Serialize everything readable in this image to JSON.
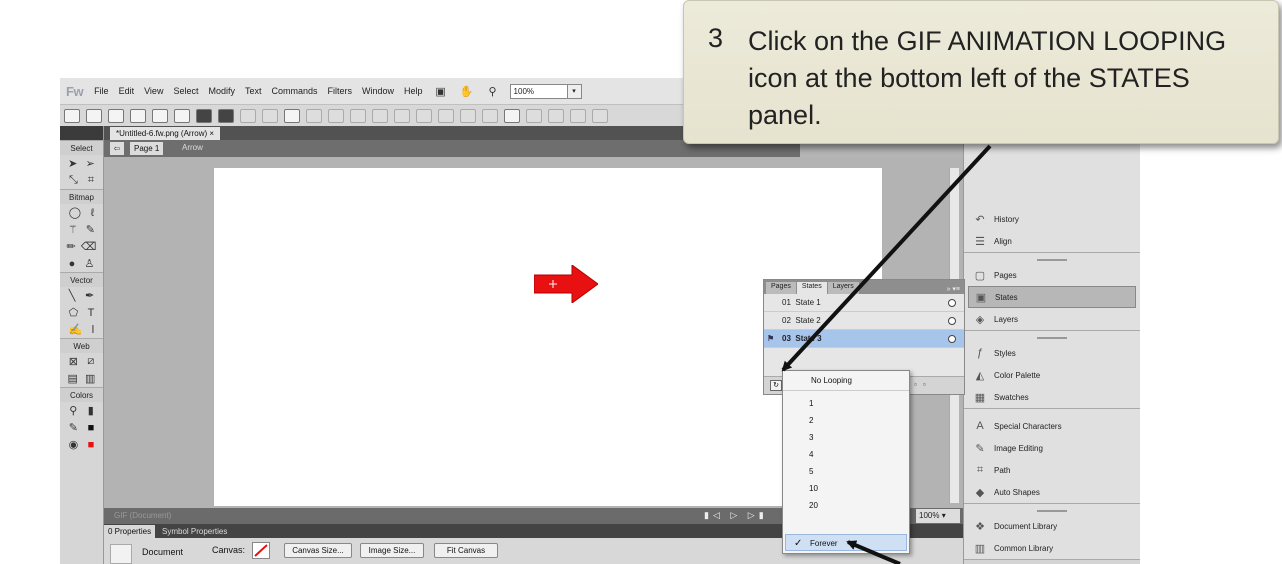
{
  "callout": {
    "step": "3",
    "text": "Click on the GIF ANIMATION LOOPING icon at the bottom left of the STATES panel."
  },
  "app": {
    "logo": "Fw",
    "menu": [
      "File",
      "Edit",
      "View",
      "Select",
      "Modify",
      "Text",
      "Commands",
      "Filters",
      "Window",
      "Help"
    ],
    "zoom": "100%",
    "document_tab": "*Untitled-6.fw.png (Arrow)",
    "tab_close": "×",
    "page_label": "Page 1",
    "layer_label": "Arrow"
  },
  "tools": {
    "sections": [
      "Select",
      "Bitmap",
      "Vector",
      "Web",
      "Colors"
    ]
  },
  "status": {
    "doc_type": "GIF (Document)",
    "playback": "▮◁ ▷ ▷▮",
    "zoom": "100%",
    "zoom_arrow": "▾"
  },
  "properties": {
    "tabs": [
      "0 Properties",
      "Symbol Properties"
    ],
    "document_label": "Document",
    "canvas_label": "Canvas:",
    "canvas_size_button": "Canvas Size...",
    "image_size_button": "Image Size...",
    "fit_canvas_button": "Fit Canvas"
  },
  "right_panel": {
    "group1": [
      "History",
      "Align"
    ],
    "group2": [
      "Pages",
      "States",
      "Layers"
    ],
    "group3": [
      "Styles",
      "Color Palette",
      "Swatches"
    ],
    "group4": [
      "Special Characters",
      "Image Editing",
      "Path",
      "Auto Shapes"
    ],
    "group5": [
      "Document Library",
      "Common Library"
    ],
    "active_item": "States"
  },
  "states_panel": {
    "tabs": [
      "Pages",
      "States",
      "Layers"
    ],
    "active_tab": "States",
    "menu": "»  ▾≡",
    "states": [
      {
        "num": "01",
        "name": "State 1",
        "selected": false
      },
      {
        "num": "02",
        "name": "State 2",
        "selected": false
      },
      {
        "num": "03",
        "name": "State 3",
        "selected": true
      }
    ]
  },
  "looping_menu": {
    "items": [
      "No Looping",
      "1",
      "2",
      "3",
      "4",
      "5",
      "10",
      "20"
    ],
    "checked": "Forever",
    "check_mark": "✓"
  },
  "colors": {
    "accent_selection": "#a7c4ea",
    "arrow_red": "#e81010",
    "callout_bg": "#e8e6d3"
  }
}
